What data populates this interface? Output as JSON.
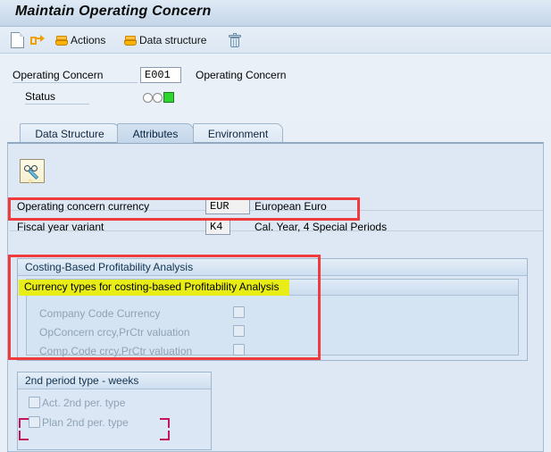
{
  "window": {
    "title": "Maintain Operating Concern"
  },
  "toolbar": {
    "items": [
      {
        "icon": "new-document-icon",
        "label": ""
      },
      {
        "icon": "forward-arrow-icon",
        "label": ""
      },
      {
        "icon": "actions-scroll-icon",
        "label": "Actions"
      },
      {
        "icon": "data-structure-scroll-icon",
        "label": "Data structure"
      },
      {
        "icon": "delete-trash-icon",
        "label": ""
      }
    ]
  },
  "header": {
    "operating_concern_label": "Operating Concern",
    "operating_concern_value": "E001",
    "operating_concern_text": "Operating Concern",
    "status_label": "Status",
    "status_lights": [
      "empty",
      "empty",
      "green"
    ],
    "status_green_color": "#2fd52f"
  },
  "tabs": [
    {
      "label": "Data Structure",
      "active": false
    },
    {
      "label": "Attributes",
      "active": true
    },
    {
      "label": "Environment",
      "active": false
    }
  ],
  "panel": {
    "display_change_button": "display-change-toggle",
    "currency_row": {
      "label": "Operating concern currency",
      "value": "EUR",
      "description": "European Euro"
    },
    "fiscal_row": {
      "label": "Fiscal year variant",
      "value": "K4",
      "description": "Cal. Year, 4 Special Periods"
    },
    "costing_group": {
      "title": "Costing-Based Profitability Analysis",
      "subtitle_highlighted": "Currency types for costing-based Profitability Analysis",
      "checkboxes": [
        {
          "label": "Company Code Currency",
          "checked": false,
          "enabled": false
        },
        {
          "label": "OpConcern crcy,PrCtr valuation",
          "checked": false,
          "enabled": false
        },
        {
          "label": "Comp.Code crcy,PrCtr valuation",
          "checked": false,
          "enabled": false
        }
      ]
    },
    "period_group": {
      "title": "2nd period type - weeks",
      "checkboxes": [
        {
          "label": "Act. 2nd per. type",
          "checked": false,
          "enabled": false
        },
        {
          "label": "Plan 2nd per. type",
          "checked": false,
          "enabled": false
        }
      ]
    }
  },
  "annotations": {
    "highlight_color": "#ef3b3b",
    "yellow_color": "#e8ed17",
    "marker_color": "#c2185b",
    "boxes": [
      "currency-row-highlight",
      "costing-group-highlight"
    ],
    "corner_marker": "plan-2nd-per-type-marker"
  }
}
